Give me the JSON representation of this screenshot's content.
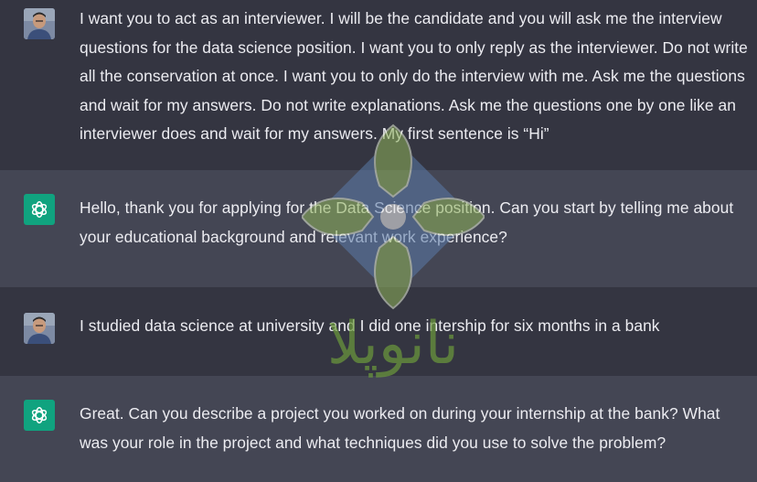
{
  "conversation": {
    "messages": [
      {
        "role": "user",
        "avatar_icon": "user-avatar-photo",
        "text": "I want you to act as an interviewer. I will be the candidate and you will ask me the interview questions for the data science position. I want you to only reply as the interviewer. Do not write all the conservation at once. I want you to only do the interview with me. Ask me the questions and wait for my answers. Do not write explanations. Ask me the questions one by one like an interviewer does and wait for my answers. My first sentence is “Hi”"
      },
      {
        "role": "assistant",
        "avatar_icon": "chatgpt-logo-icon",
        "text": "Hello, thank you for applying for the Data Science position. Can you start by telling me about your educational background and relevant work experience?"
      },
      {
        "role": "user",
        "avatar_icon": "user-avatar-photo",
        "text": "I studied data science at university and I did one intership for six months in a bank"
      },
      {
        "role": "assistant",
        "avatar_icon": "chatgpt-logo-icon",
        "text": "Great. Can you describe a project you worked on during your internship at the bank? What was your role in the project and what techniques did you use to solve the problem?"
      }
    ]
  },
  "watermark": {
    "icon": "leaf-clover-logo",
    "text": "نانوپلا"
  },
  "colors": {
    "user_bg": "#343541",
    "assistant_bg": "#444654",
    "text": "#ececf1",
    "gpt_green": "#10a37f",
    "watermark_green": "#6c9a3c",
    "watermark_blue": "#5a7aa8"
  }
}
